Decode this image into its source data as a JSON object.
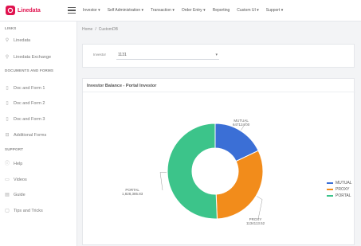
{
  "app": {
    "brand": "Linedata"
  },
  "nav": [
    {
      "label": "Investor ▾"
    },
    {
      "label": "Self Administration ▾"
    },
    {
      "label": "Transaction ▾"
    },
    {
      "label": "Order Entry ▾"
    },
    {
      "label": "Reporting"
    },
    {
      "label": "Custom UI ▾"
    },
    {
      "label": "Support ▾"
    }
  ],
  "sidebar": {
    "sections": [
      {
        "heading": "LINKS",
        "items": [
          {
            "label": "Linedata",
            "icon": "link-icon"
          },
          {
            "label": "Linedata Exchange",
            "icon": "link-icon"
          }
        ]
      },
      {
        "heading": "DOCUMENTS AND FORMS",
        "items": [
          {
            "label": "Doc and Form 1",
            "icon": "document-icon"
          },
          {
            "label": "Doc and Form 2",
            "icon": "document-icon"
          },
          {
            "label": "Doc and Form 3",
            "icon": "document-icon"
          },
          {
            "label": "Additional Forms",
            "icon": "forms-icon"
          }
        ]
      },
      {
        "heading": "SUPPORT",
        "items": [
          {
            "label": "Help",
            "icon": "help-icon"
          },
          {
            "label": "Videos",
            "icon": "video-icon"
          },
          {
            "label": "Guide",
            "icon": "guide-icon"
          },
          {
            "label": "Tips and Tricks",
            "icon": "tips-icon"
          }
        ]
      }
    ]
  },
  "breadcrumb": {
    "home": "Home",
    "sep": "/",
    "current": "CustomDB"
  },
  "filter": {
    "label": "Investor",
    "value": "1131"
  },
  "card": {
    "title": "Investor Balance - Portal Investor"
  },
  "colors": {
    "accent": "#e0134f",
    "mutual": "#3b6fd6",
    "proxy": "#f28c1b",
    "portal": "#3cc48a"
  },
  "chart_data": {
    "type": "pie",
    "donut": true,
    "title": "",
    "series": [
      {
        "name": "MUTUAL",
        "value": 647124.0,
        "label": "MUTUAL",
        "value_label": "647124.00",
        "color": "#3b6fd6"
      },
      {
        "name": "PROXY",
        "value": 1134113.52,
        "label": "PROXY",
        "value_label": "1134113.52",
        "color": "#f28c1b"
      },
      {
        "name": "PORTAL",
        "value": 1828385.83,
        "label": "PORTAL",
        "value_label": "1,828,385.83",
        "color": "#3cc48a"
      }
    ],
    "legend_position": "right"
  }
}
